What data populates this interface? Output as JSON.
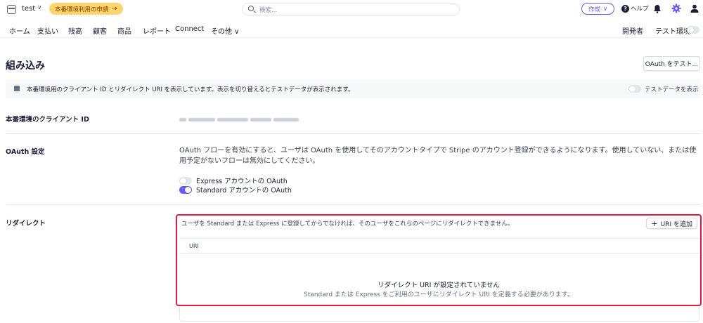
{
  "topbar": {
    "account_name": "test",
    "account_chevron": "∨",
    "live_pill_label": "本番環境利用の申請",
    "live_pill_arrow": "→",
    "search_placeholder": "検索...",
    "create_label": "作成",
    "create_chevron": "∨",
    "help_label": "ヘルプ",
    "help_glyph": "?",
    "icons": [
      "account-icon",
      "search-icon",
      "help-icon",
      "bell-icon",
      "gear-icon",
      "user-icon"
    ]
  },
  "nav": {
    "items": [
      "ホーム",
      "支払い",
      "残高",
      "顧客",
      "商品",
      "レポート",
      "Connect",
      "その他 ∨"
    ],
    "developer": "開発者",
    "test_env": "テスト環境",
    "test_env_on": false
  },
  "page": {
    "title": "組み込み",
    "oauth_test_button": "OAuth をテスト..."
  },
  "banner": {
    "text": "本番環境用のクライアント ID とリダイレクト URI を表示しています。表示を切り替えるとテストデータが表示されます。",
    "toggle_label": "テストデータを表示",
    "toggle_on": false
  },
  "client_id": {
    "label": "本番環境のクライアント ID"
  },
  "oauth_settings": {
    "label": "OAuth 設定",
    "description": "OAuth フローを有効にすると、ユーザは OAuth を使用してそのアカウントタイプで Stripe のアカウント登録ができるようになります。使用していない、または使用予定がないフローは無効にしてください。",
    "options": [
      {
        "label": "Express アカウントの OAuth",
        "on": false
      },
      {
        "label": "Standard アカウントの OAuth",
        "on": true
      }
    ]
  },
  "redirect": {
    "label": "リダイレクト",
    "description": "ユーザを Standard または Express に登録してからでなければ、そのユーザをこれらのページにリダイレクトできません。",
    "add_button": "URI を追加",
    "add_glyph": "+",
    "column_header": "URI",
    "empty_title": "リダイレクト URI が設定されていません",
    "empty_subtitle": "Standard または Express をご利用のユーザにリダイレクト URI を定義する必要があります。"
  },
  "colors": {
    "accent": "#635bff",
    "live_pill": "#fcd66c",
    "highlight_border": "#df1b41"
  }
}
